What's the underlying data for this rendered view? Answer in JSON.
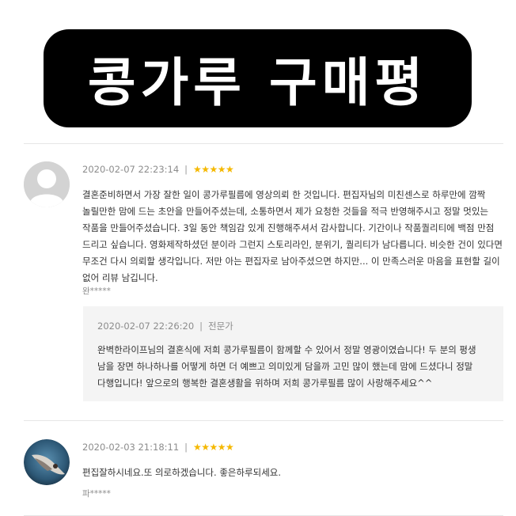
{
  "banner": {
    "title": "콩가루 구매평"
  },
  "reviews": [
    {
      "date": "2020-02-07 22:23:14",
      "separator": "|",
      "stars": "★★★★★",
      "text": "결혼준비하면서 가장 잘한 일이 콩가루필름에 영상의뢰 한 것입니다. 편집자님의 미친센스로 하루만에 깜짝 놀릴만한 맘에 드는 초안을 만들어주셨는데, 소통하면서 제가 요청한 것들을 적극 반영해주시고 정말 멋있는 작품을 만들어주셨습니다. 3일 동안 책임감 있게 진행해주셔서 감사합니다. 기간이나 작품퀄리티에 백점 만점 드리고 싶습니다. 영화제작하셨던 분이라 그런지 스토리라인, 분위기, 퀄리티가 남다릅니다. 비슷한 건이 있다면 무조건 다시 의뢰할 생각입니다. 저만 아는 편집자로 남아주셨으면 하지만... 이 만족스러운 마음을 표현할 길이 없어 리뷰 남깁니다.",
      "author": "완*****",
      "reply": {
        "date": "2020-02-07 22:26:20",
        "separator": "|",
        "label": "전문가",
        "text": "완벽한라이프님의 결혼식에 저희 콩가루필름이 함께할 수 있어서 정말 영광이였습니다! 두 분의 평생 남을 장면 하나하나를 어떻게 하면 더 예쁘고 의미있게 담을까 고민 많이 했는데 맘에 드셨다니 정말 다행입니다! 앞으로의 행복한 결혼생활을 위하며 저희 콩가루필름 많이 사랑해주세요^^"
      }
    },
    {
      "date": "2020-02-03 21:18:11",
      "separator": "|",
      "stars": "★★★★★",
      "text": "편집잘하시네요.또 의로하겠습니다. 좋은하루되세요.",
      "author": "파*****"
    }
  ],
  "colors": {
    "star": "#f5b800",
    "reply_bg": "#f4f4f4",
    "banner_bg": "#000000"
  },
  "icons": {
    "avatar1": "default-person-icon",
    "avatar2": "profile-photo"
  }
}
